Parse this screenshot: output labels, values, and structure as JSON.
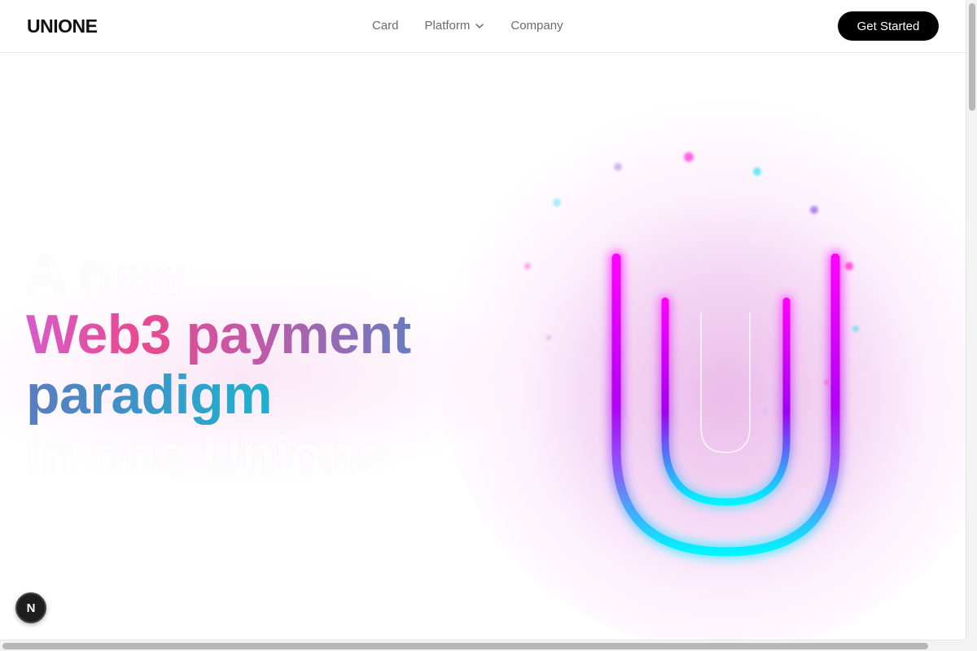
{
  "header": {
    "logo": "UNIONE",
    "nav": [
      {
        "label": "Card"
      },
      {
        "label": "Platform",
        "icon": "chevron-down-icon"
      },
      {
        "label": "Company"
      }
    ],
    "cta_label": "Get Started"
  },
  "hero": {
    "line_top_faded": "A new",
    "line_1": "Web3 payment",
    "line_2": "paradigm",
    "line_bottom_faded": "in one Unione",
    "colors": {
      "pink": "#e84a90",
      "magenta": "#ff00ff",
      "purple": "#8a2be2",
      "cyan": "#00f5ff"
    }
  },
  "badge": {
    "label": "N"
  }
}
